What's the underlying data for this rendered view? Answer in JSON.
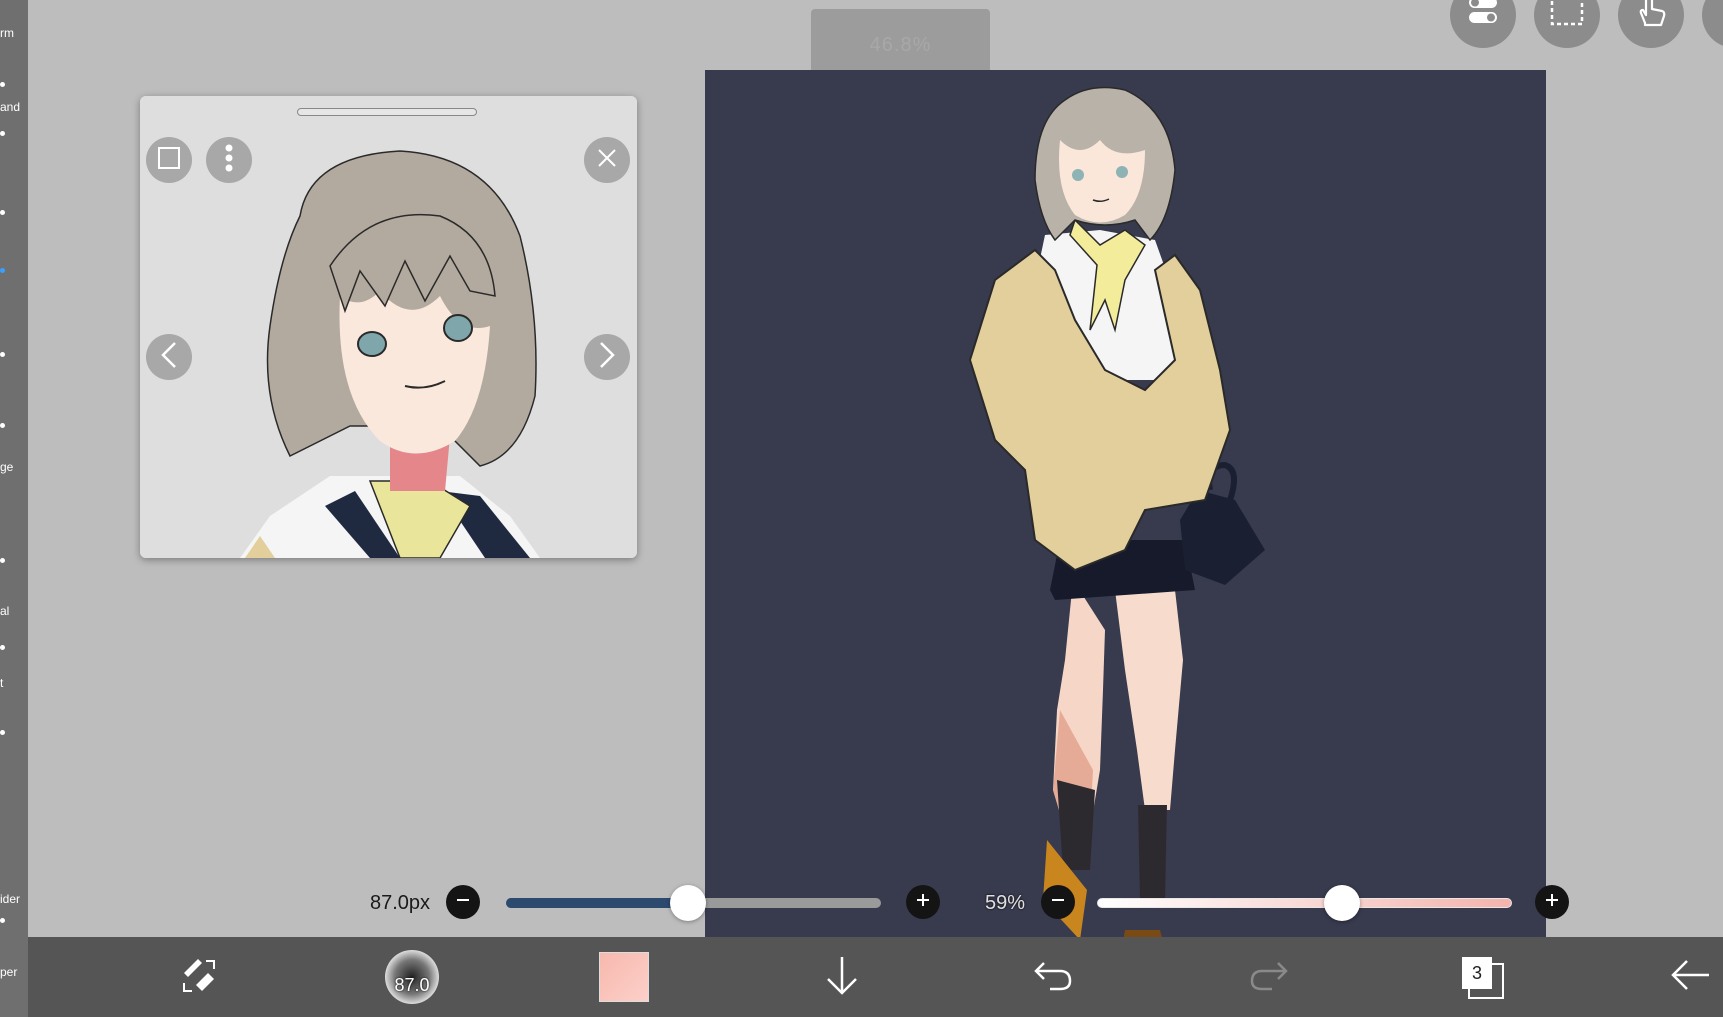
{
  "app": {
    "zoom_readout": "46.8%"
  },
  "left_toolbar": {
    "labels": [
      "rm",
      "and",
      "ge",
      "al",
      "t",
      "ider",
      "per"
    ]
  },
  "top_right_buttons": [
    {
      "name": "toggle-icon"
    },
    {
      "name": "selection-icon"
    },
    {
      "name": "hand-icon"
    }
  ],
  "reference_window": {
    "title": ""
  },
  "brush_size": {
    "label": "87.0px",
    "value": 87.0,
    "fraction": 0.485
  },
  "opacity": {
    "label": "59%",
    "value": 59,
    "fraction": 0.59
  },
  "bottom_toolbar": {
    "brush_preview_label": "87.0",
    "layer_count": "3",
    "color_swatch": "#f7b8ae",
    "items": [
      {
        "name": "brush-eraser-swap-icon"
      },
      {
        "name": "brush-size-preview"
      },
      {
        "name": "color-swatch"
      },
      {
        "name": "save-download-icon"
      },
      {
        "name": "undo-icon"
      },
      {
        "name": "redo-icon"
      },
      {
        "name": "layers-icon"
      },
      {
        "name": "back-arrow-icon"
      }
    ]
  },
  "colors": {
    "canvas_bg": "#383a4e",
    "brush_track": "#2c4a6e",
    "opacity_track": "#f4b3ac",
    "toolbar_bg": "#555555"
  }
}
